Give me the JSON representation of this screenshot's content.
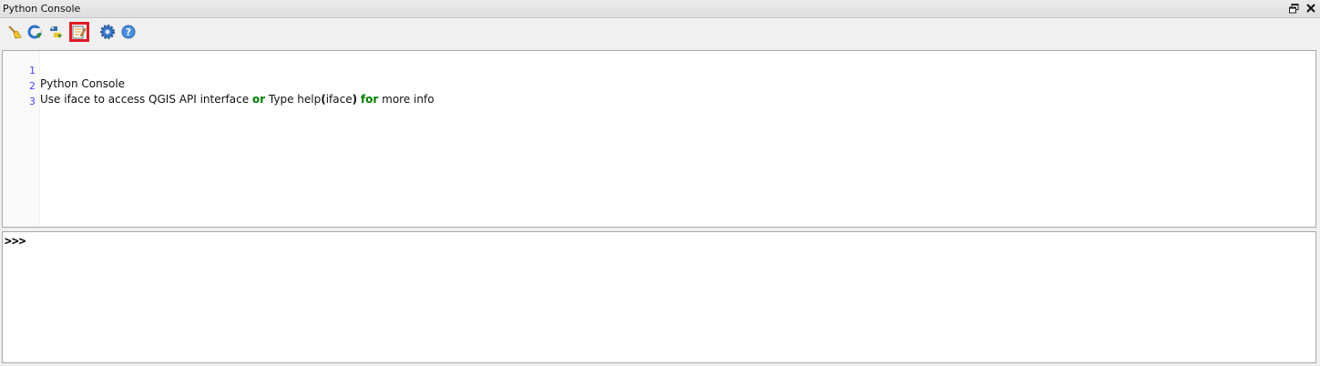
{
  "window": {
    "title": "Python Console",
    "float_icon": "float-restore-icon",
    "close_icon": "close-icon"
  },
  "toolbar": {
    "buttons": [
      {
        "name": "clear-console-button",
        "icon": "broom-icon"
      },
      {
        "name": "run-command-button",
        "icon": "refresh-run-icon"
      },
      {
        "name": "import-class-button",
        "icon": "python-import-icon"
      },
      {
        "name": "show-editor-button",
        "icon": "editor-notepad-icon",
        "highlighted": true
      },
      {
        "name": "settings-button",
        "icon": "gear-icon"
      },
      {
        "name": "help-button",
        "icon": "help-icon"
      }
    ],
    "highlight_color": "#e01b24"
  },
  "editor": {
    "lines": [
      {
        "number": "1",
        "text": "Python Console"
      },
      {
        "number": "2",
        "parts": [
          "Use iface to access QGIS API interface ",
          "or",
          " Type help",
          "(",
          "iface",
          ")",
          " ",
          "for",
          " more info"
        ]
      },
      {
        "number": "3",
        "text": ""
      }
    ],
    "keyword_color": "#008000",
    "line_number_color": "#4545ff"
  },
  "shell": {
    "prompt": ">>>",
    "value": ""
  }
}
